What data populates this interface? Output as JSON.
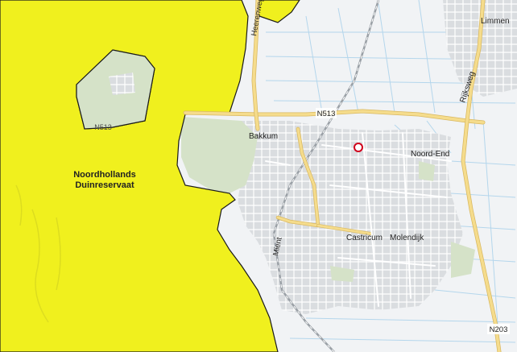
{
  "colors": {
    "reserve": "#f0f01e",
    "reserve_border": "#1a1a1a",
    "land": "#f1f3f5",
    "urban": "#d9dcdf",
    "green": "#d5e2c8",
    "road": "#f5dc8c",
    "road_edge": "#d9b860",
    "water": "#b4d6ec",
    "marker": "#d0021b"
  },
  "labels": {
    "reserve_name": "Noordhollands\nDuinreservaat",
    "reserve_name_line1": "Noordhollands",
    "reserve_name_line2": "Duinreservaat",
    "road_n513_east": "N513",
    "road_n513_west": "N513",
    "road_n203": "N203",
    "road_rijksweg": "Rijksweg",
    "road_mient": "Mient",
    "road_heerenweg": "Heerenweg",
    "place_bakkum": "Bakkum",
    "place_noord_end": "Noord-End",
    "place_castricum": "Castricum",
    "place_molendijk": "Molendijk",
    "place_limmen": "Limmen"
  },
  "marker": {
    "icon": "location-ring-icon"
  }
}
